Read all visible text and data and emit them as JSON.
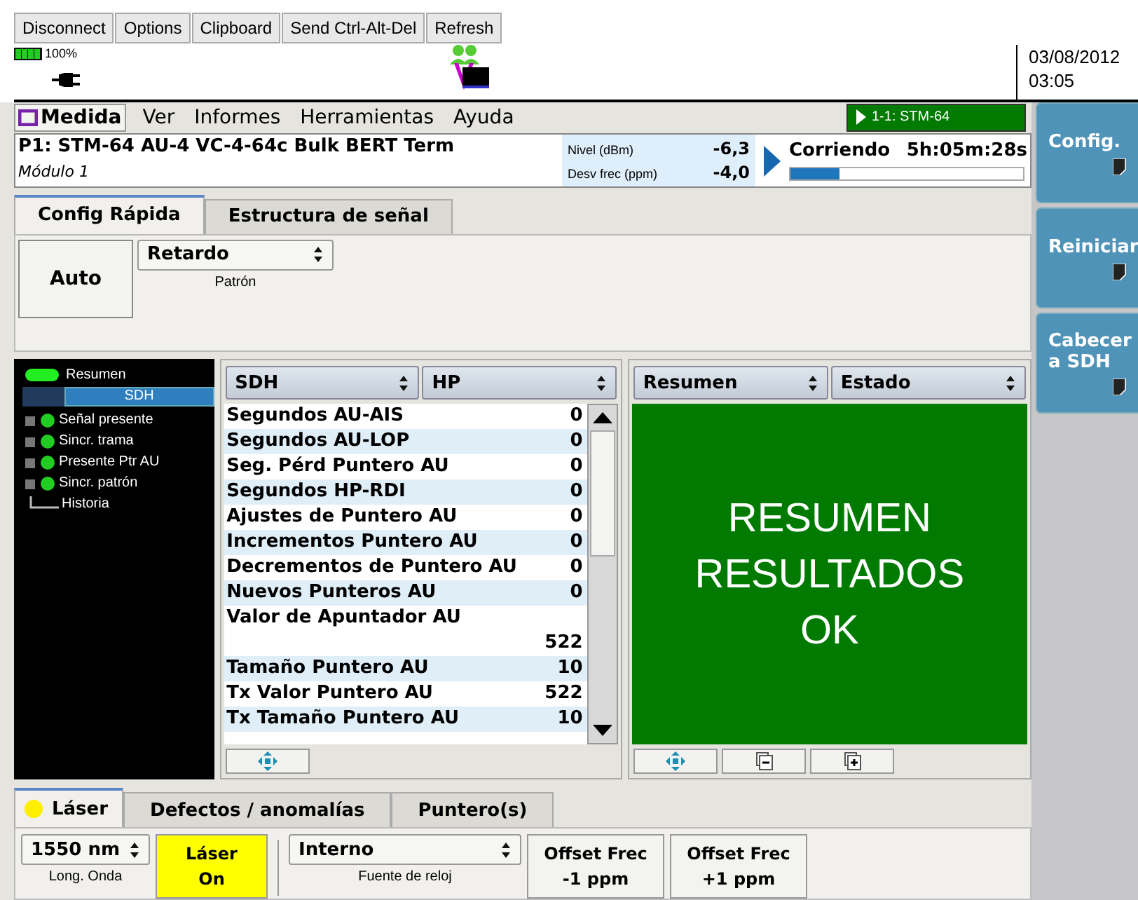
{
  "toolbar": {
    "buttons": [
      "Disconnect",
      "Options",
      "Clipboard",
      "Send Ctrl-Alt-Del",
      "Refresh"
    ]
  },
  "status": {
    "battery": "100%",
    "date": "03/08/2012",
    "time": "03:05"
  },
  "menu": [
    {
      "label": "Medida",
      "selected": true
    },
    {
      "label": "Ver",
      "selected": false
    },
    {
      "label": "Informes",
      "selected": false
    },
    {
      "label": "Herramientas",
      "selected": false
    },
    {
      "label": "Ayuda",
      "selected": false
    }
  ],
  "port_badge": "1-1: STM-64",
  "header": {
    "title": "P1: STM-64 AU-4 VC-4-64c Bulk BERT Term",
    "module": "Módulo 1",
    "readings": [
      {
        "label": "Nivel (dBm)",
        "value": "-6,3"
      },
      {
        "label": "Desv frec (ppm)",
        "value": "-4,0"
      }
    ],
    "run_state": "Corriendo",
    "elapsed": "5h:05m:28s",
    "level": 0.21
  },
  "tabs": [
    {
      "label": "Config Rápida",
      "selected": true
    },
    {
      "label": "Estructura de señal",
      "selected": false
    }
  ],
  "quick_config": {
    "auto_button": "Auto",
    "pattern": {
      "value": "Retardo",
      "label": "Patrón"
    }
  },
  "tree": {
    "summary": "Resumen",
    "selected_item": "SDH",
    "items": [
      {
        "label": "Señal presente",
        "color": "#22cc22"
      },
      {
        "label": "Sincr. trama",
        "color": "#22cc22"
      },
      {
        "label": "Presente Ptr AU",
        "color": "#22cc22"
      },
      {
        "label": "Sincr. patrón",
        "color": "#22cc22"
      },
      {
        "label": "Historia"
      }
    ]
  },
  "results_table": {
    "selectors": [
      "SDH",
      "HP"
    ],
    "rows": [
      {
        "label": "Segundos AU-AIS",
        "value": "0",
        "kind": "single"
      },
      {
        "label": "Segundos AU-LOP",
        "value": "0",
        "kind": "single"
      },
      {
        "label": "Seg. Pérd Puntero AU",
        "value": "0",
        "kind": "single"
      },
      {
        "label": "Segundos HP-RDI",
        "value": "0",
        "kind": "single"
      },
      {
        "label": "Ajustes de Puntero AU",
        "value": "0",
        "kind": "single"
      },
      {
        "label": "Incrementos Puntero AU",
        "value": "0",
        "kind": "single"
      },
      {
        "label": "Decrementos de Puntero AU",
        "value": "0",
        "kind": "single"
      },
      {
        "label": "Nuevos Punteros AU",
        "value": "0",
        "kind": "single"
      },
      {
        "label": "Valor de Apuntador AU",
        "value": "522",
        "kind": "wrapped"
      },
      {
        "label": "Tamaño Puntero AU",
        "value": "10",
        "kind": "single"
      },
      {
        "label": "Tx Valor Puntero AU",
        "value": "522",
        "kind": "single"
      },
      {
        "label": "Tx Tamaño Puntero AU",
        "value": "10",
        "kind": "single"
      }
    ]
  },
  "summary_panel": {
    "selectors": [
      "Resumen",
      "Estado"
    ],
    "message": [
      "RESUMEN",
      "RESULTADOS",
      "OK"
    ]
  },
  "bottom_tabs": [
    {
      "label": "Láser",
      "selected": true,
      "color": "#ffee00"
    },
    {
      "label": "Defectos / anomalías",
      "selected": false
    },
    {
      "label": "Puntero(s)",
      "selected": false
    }
  ],
  "laser": {
    "wavelength": {
      "value": "1550 nm",
      "label": "Long. Onda"
    },
    "laser_button": [
      "Láser",
      "On"
    ],
    "laser_on": true,
    "clock": {
      "value": "Interno",
      "label": "Fuente de reloj"
    },
    "offset_buttons": [
      [
        "Offset Frec",
        "-1 ppm"
      ],
      [
        "Offset Frec",
        "+1 ppm"
      ]
    ]
  },
  "side_buttons": [
    {
      "label": "Config."
    },
    {
      "label": "Reiniciar"
    },
    {
      "label": "Cabecera SDH"
    }
  ]
}
